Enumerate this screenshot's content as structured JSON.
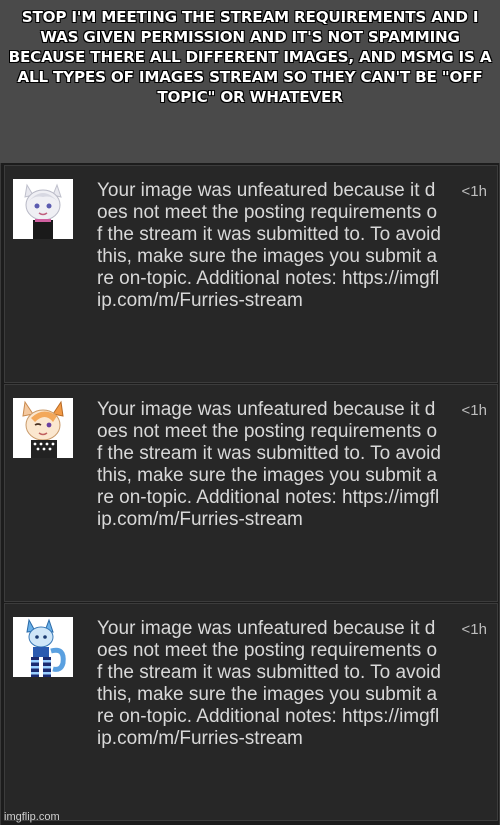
{
  "caption": "STOP I'M MEETING THE STREAM REQUIREMENTS AND I WAS GIVEN PERMISSION AND IT'S NOT SPAMMING BECAUSE THERE ALL DIFFERENT IMAGES, AND MSMG IS A ALL TYPES OF IMAGES STREAM SO THEY CAN'T BE \"OFF TOPIC\" OR WHATEVER",
  "notifications": [
    {
      "thumbnail": "furry-character-thumbnail-white",
      "message": "Your image was unfeatured because it does not meet the posting requirements of the stream it was submitted to. To avoid this, make sure the images you submit are on-topic. Additional notes: https://imgflip.com/m/Furries-stream",
      "time": "<1h"
    },
    {
      "thumbnail": "furry-character-thumbnail-orange",
      "message": "Your image was unfeatured because it does not meet the posting requirements of the stream it was submitted to. To avoid this, make sure the images you submit are on-topic. Additional notes: https://imgflip.com/m/Furries-stream",
      "time": "<1h"
    },
    {
      "thumbnail": "furry-character-thumbnail-blue",
      "message": "Your image was unfeatured because it does not meet the posting requirements of the stream it was submitted to. To avoid this, make sure the images you submit are on-topic. Additional notes: https://imgflip.com/m/Furries-stream",
      "time": "<1h"
    }
  ],
  "watermark": "imgflip.com",
  "colors": {
    "caption_bg": "#4a4a4a",
    "list_bg": "#1c1c1c",
    "card_bg": "#272727",
    "message_text": "#d8d8d8",
    "caption_text": "#ffffff"
  }
}
